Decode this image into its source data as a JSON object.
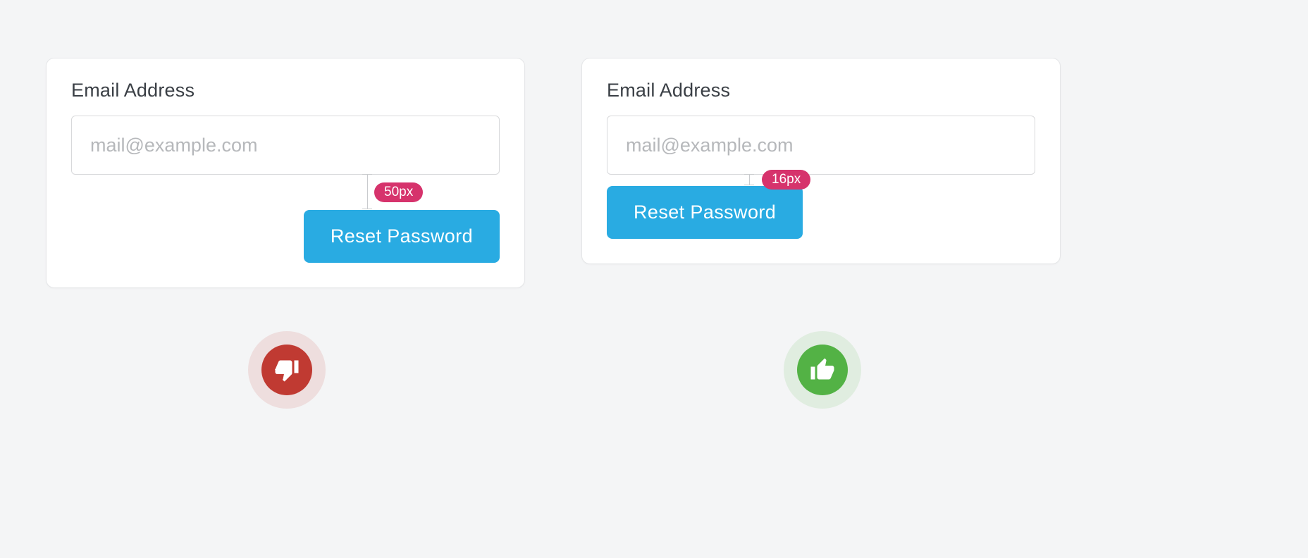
{
  "examples": {
    "bad": {
      "label": "Email Address",
      "placeholder": "mail@example.com",
      "button": "Reset Password",
      "spacing_label": "50px"
    },
    "good": {
      "label": "Email Address",
      "placeholder": "mail@example.com",
      "button": "Reset Password",
      "spacing_label": "16px"
    }
  }
}
